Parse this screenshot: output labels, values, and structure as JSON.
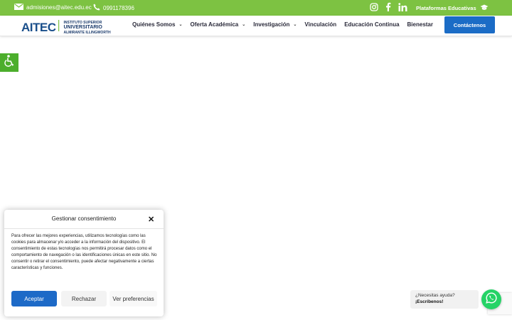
{
  "topbar": {
    "email": "admisiones@aitec.edu.ec",
    "phone": "0991178396",
    "platforms_label": "Plataformas Educativas"
  },
  "logo": {
    "wordmark": "AITEC",
    "line1": "INSTITUTO SUPERIOR",
    "line2": "UNIVERSITARIO",
    "line3": "ALMIRANTE ILLINGWORTH"
  },
  "nav": {
    "items": [
      {
        "label": "Quiénes Somos"
      },
      {
        "label": "Oferta Académica"
      },
      {
        "label": "Investigación"
      },
      {
        "label": "Vinculación"
      },
      {
        "label": "Educación Continua"
      },
      {
        "label": "Bienestar"
      }
    ],
    "contact_label": "Contáctenos"
  },
  "consent": {
    "title": "Gestionar consentimiento",
    "body": "Para ofrecer las mejores experiencias, utilizamos tecnologías como las cookies para almacenar y/o acceder a la información del dispositivo. El consentimiento de estas tecnologías nos permitirá procesar datos como el comportamiento de navegación o las identificaciones únicas en este sitio. No consentir o retirar el consentimiento, puede afectar negativamente a ciertas características y funciones.",
    "accept_label": "Aceptar",
    "reject_label": "Rechazar",
    "prefs_label": "Ver preferencias"
  },
  "help": {
    "line1": "¿Necesitas ayuda?",
    "line2": "¡Escríbenos!"
  },
  "colors": {
    "topbar": "#7dc242",
    "primary": "#1b6cc6",
    "accessibility": "#4cae2c",
    "whatsapp": "#25d366"
  }
}
